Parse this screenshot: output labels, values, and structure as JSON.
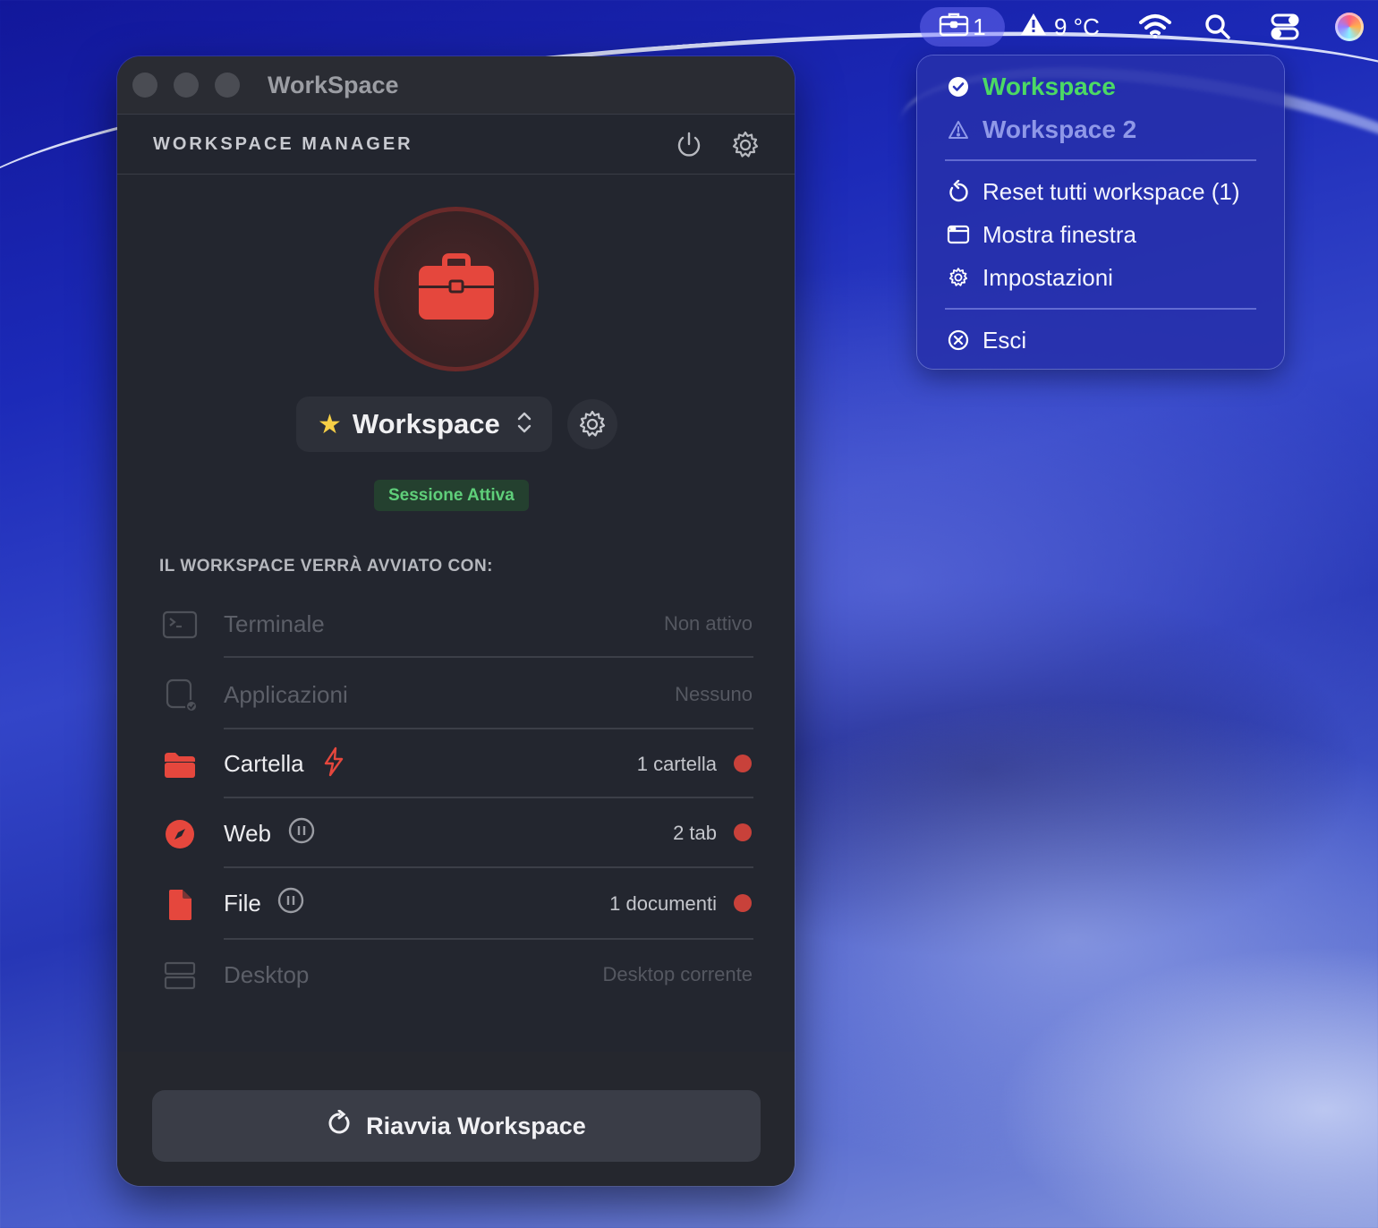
{
  "menubar": {
    "workspace_count": "1",
    "temperature": "9 °C"
  },
  "window": {
    "title": "WorkSpace",
    "header_title": "WORKSPACE MANAGER"
  },
  "workspace": {
    "name": "Workspace",
    "status": "Sessione Attiva",
    "star_glyph": "★"
  },
  "modules": {
    "section_title": "IL WORKSPACE VERRÀ AVVIATO CON:",
    "items": [
      {
        "label": "Terminale",
        "value": "Non attivo",
        "active": false
      },
      {
        "label": "Applicazioni",
        "value": "Nessuno",
        "active": false
      },
      {
        "label": "Cartella",
        "value": "1 cartella",
        "active": true
      },
      {
        "label": "Web",
        "value": "2 tab",
        "active": true
      },
      {
        "label": "File",
        "value": "1 documenti",
        "active": true
      },
      {
        "label": "Desktop",
        "value": "Desktop corrente",
        "active": false
      }
    ]
  },
  "footer": {
    "restart_label": "Riavvia Workspace"
  },
  "menu": {
    "workspaces": [
      {
        "label": "Workspace",
        "state": "active"
      },
      {
        "label": "Workspace 2",
        "state": "warning"
      }
    ],
    "actions": [
      {
        "label": "Reset tutti workspace (1)"
      },
      {
        "label": "Mostra finestra"
      },
      {
        "label": "Impostazioni"
      }
    ],
    "quit": {
      "label": "Esci"
    }
  },
  "colors": {
    "accent_red": "#e5473d",
    "active_green": "#5fcf7a",
    "menu_active_green": "#4cd964",
    "menu_bg": "#2630aa",
    "window_bg": "#23262f"
  }
}
